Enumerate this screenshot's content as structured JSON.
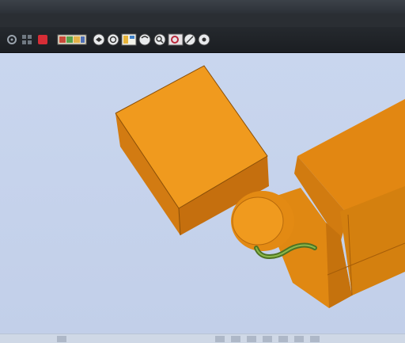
{
  "window": {
    "title": ""
  },
  "menubar": {
    "text": ""
  },
  "toolbar": {
    "buttons": [
      {
        "name": "settings-icon"
      },
      {
        "name": "grid-icon"
      },
      {
        "name": "record-icon"
      },
      {
        "name": "palette-icon"
      },
      {
        "name": "view-cube-icon"
      },
      {
        "name": "rotate-icon"
      },
      {
        "name": "display-mode-icon"
      },
      {
        "name": "pan-icon"
      },
      {
        "name": "zoom-icon"
      },
      {
        "name": "section-icon"
      },
      {
        "name": "measure-icon"
      }
    ]
  },
  "colors": {
    "viewport_background": "#c6d3ec",
    "part_face_light": "#f09a1e",
    "part_face_side": "#d77d10",
    "part_face_dark": "#b86a0c",
    "wire": "#5f8a2a"
  }
}
